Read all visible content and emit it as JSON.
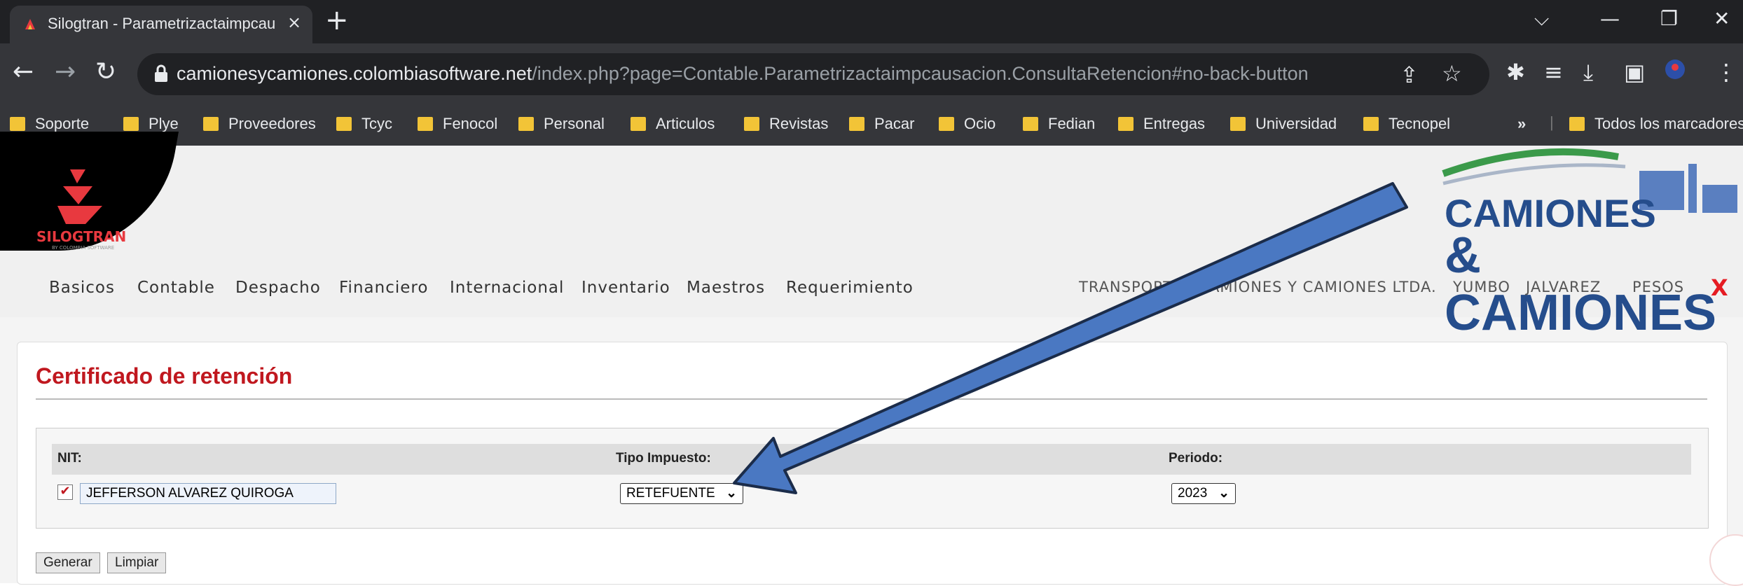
{
  "browser": {
    "tab_title": "Silogtran - Parametrizactaimpcau",
    "tab_close": "×",
    "new_tab": "+",
    "url_host": "camionesycamiones.colombiasoftware.net",
    "url_path": "/index.php?page=Contable.Parametrizactaimpcausacion.ConsultaRetencion#no-back-button",
    "bookmarks": [
      "Soporte",
      "Plye",
      "Proveedores",
      "Tcyc",
      "Fenocol",
      "Personal",
      "Articulos",
      "Revistas",
      "Pacar",
      "Ocio",
      "Fedian",
      "Entregas",
      "Universidad",
      "Tecnopel"
    ],
    "bookmarks_overflow": "»",
    "all_bookmarks": "Todos los marcadores"
  },
  "app": {
    "logo_text": "SILOGTRAN",
    "logo_sub": "BY COLOMBIA SOFTWARE",
    "brand_line1": "CAMIONES",
    "brand_line2": "& CAMIONES",
    "menu": [
      "Basicos",
      "Contable",
      "Despacho",
      "Financiero",
      "Internacional",
      "Inventario",
      "Maestros",
      "Requerimiento"
    ],
    "company": "TRANSPORTES CAMIONES Y CAMIONES LTDA.",
    "city": "YUMBO",
    "user": "JALVAREZ",
    "currency": "PESOS",
    "exit": "X"
  },
  "form": {
    "title": "Certificado de retención",
    "nit_label": "NIT:",
    "tipo_label": "Tipo Impuesto:",
    "periodo_label": "Periodo:",
    "nit_value": "JEFFERSON ALVAREZ QUIROGA",
    "nit_checked": true,
    "tipo_value": "RETEFUENTE",
    "periodo_value": "2023",
    "generate_label": "Generar",
    "clear_label": "Limpiar"
  },
  "colors": {
    "accent_red": "#c0181f",
    "annotation_arrow": "#4a78c2",
    "brand_blue": "#254d8c"
  }
}
